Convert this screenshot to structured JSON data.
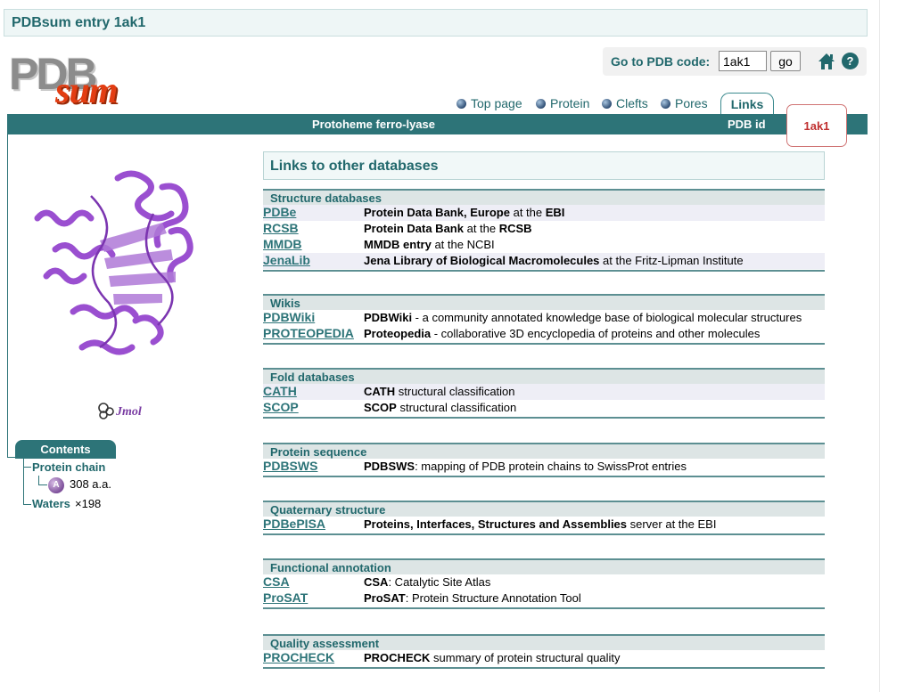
{
  "title": "PDBsum entry 1ak1",
  "logo": {
    "part1": "PDB",
    "part2": "sum"
  },
  "goto": {
    "label": "Go to PDB code:",
    "value": "1ak1",
    "button": "go"
  },
  "nav": [
    "Top page",
    "Protein",
    "Clefts",
    "Pores"
  ],
  "active_tab": "Links",
  "header": {
    "protein_name": "Protoheme ferro-lyase",
    "pdbid_label": "PDB id",
    "pdbid_value": "1ak1"
  },
  "jsmol_label": "Jmol",
  "contents": {
    "title": "Contents",
    "protein_chain": "Protein chain",
    "chain_letter": "A",
    "chain_length": "308 a.a.",
    "waters": "Waters",
    "waters_count": "×198"
  },
  "main_title": "Links to other databases",
  "groups": [
    {
      "heading": "Structure databases",
      "rows": [
        {
          "db": "PDBe",
          "desc_bold": "Protein Data Bank, Europe",
          "desc_rest": " at the ",
          "desc_bold2": "EBI",
          "desc_rest2": ""
        },
        {
          "db": "RCSB",
          "desc_bold": "Protein Data Bank",
          "desc_rest": " at the ",
          "desc_bold2": "RCSB",
          "desc_rest2": ""
        },
        {
          "db": "MMDB",
          "desc_bold": "MMDB entry",
          "desc_rest": " at the NCBI",
          "desc_bold2": "",
          "desc_rest2": ""
        },
        {
          "db": "JenaLib",
          "desc_bold": "Jena Library of Biological Macromolecules",
          "desc_rest": " at the Fritz-Lipman Institute",
          "desc_bold2": "",
          "desc_rest2": ""
        }
      ]
    },
    {
      "heading": "Wikis",
      "rows": [
        {
          "db": "PDBWiki",
          "desc_bold": "PDBWiki",
          "desc_rest": " - a community annotated knowledge base of biological molecular structures",
          "desc_bold2": "",
          "desc_rest2": ""
        },
        {
          "db": "PROTEOPEDIA",
          "desc_bold": "Proteopedia",
          "desc_rest": " - collaborative 3D encyclopedia of proteins and other molecules",
          "desc_bold2": "",
          "desc_rest2": ""
        }
      ]
    },
    {
      "heading": "Fold databases",
      "rows": [
        {
          "db": "CATH",
          "desc_bold": "CATH",
          "desc_rest": " structural classification",
          "desc_bold2": "",
          "desc_rest2": ""
        },
        {
          "db": "SCOP",
          "desc_bold": "SCOP",
          "desc_rest": " structural classification",
          "desc_bold2": "",
          "desc_rest2": ""
        }
      ]
    },
    {
      "heading": "Protein sequence",
      "rows": [
        {
          "db": "PDBSWS",
          "desc_bold": "PDBSWS",
          "desc_rest": ": mapping of PDB protein chains to SwissProt entries",
          "desc_bold2": "",
          "desc_rest2": ""
        }
      ]
    },
    {
      "heading": "Quaternary structure",
      "rows": [
        {
          "db": "PDBePISA",
          "desc_bold": "Proteins, Interfaces, Structures and Assemblies",
          "desc_rest": " server at the EBI",
          "desc_bold2": "",
          "desc_rest2": ""
        }
      ]
    },
    {
      "heading": "Functional annotation",
      "rows": [
        {
          "db": "CSA",
          "desc_bold": "CSA",
          "desc_rest": ": Catalytic Site Atlas",
          "desc_bold2": "",
          "desc_rest2": ""
        },
        {
          "db": "ProSAT",
          "desc_bold": "ProSAT",
          "desc_rest": ": Protein Structure Annotation Tool",
          "desc_bold2": "",
          "desc_rest2": ""
        }
      ]
    },
    {
      "heading": "Quality assessment",
      "rows": [
        {
          "db": "PROCHECK",
          "desc_bold": "PROCHECK",
          "desc_rest": " summary of protein structural quality",
          "desc_bold2": "",
          "desc_rest2": ""
        }
      ]
    }
  ]
}
